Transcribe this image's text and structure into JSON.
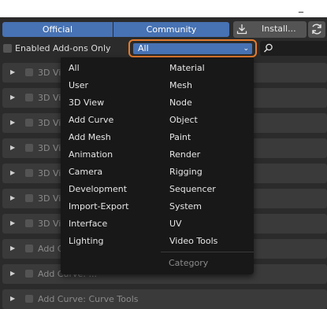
{
  "titlebar": {
    "minimize_glyph": "_"
  },
  "tabs": {
    "official": "Official",
    "community": "Community"
  },
  "toolbar": {
    "install_label": "Install...",
    "install_icon": "download-icon",
    "refresh_icon": "refresh-icon"
  },
  "filter": {
    "enabled_only_label": "Enabled Add-ons Only",
    "category_value": "All",
    "search_icon": "search-icon"
  },
  "addon_rows": [
    "3D View: ...",
    "3D View: ...",
    "3D View: ...",
    "3D View: ...",
    "3D View: ...",
    "3D View: ...",
    "3D View: ...",
    "Add Curve: ...",
    "Add Curve: ...",
    "Add Curve: Curve Tools"
  ],
  "category_menu": {
    "header": "Category",
    "left_column": [
      "All",
      "User",
      "3D View",
      "Add Curve",
      "Add Mesh",
      "Animation",
      "Camera",
      "Development",
      "Import-Export",
      "Interface",
      "Lighting"
    ],
    "right_column": [
      "Material",
      "Mesh",
      "Node",
      "Object",
      "Paint",
      "Render",
      "Rigging",
      "Sequencer",
      "System",
      "UV",
      "Video Tools"
    ]
  }
}
